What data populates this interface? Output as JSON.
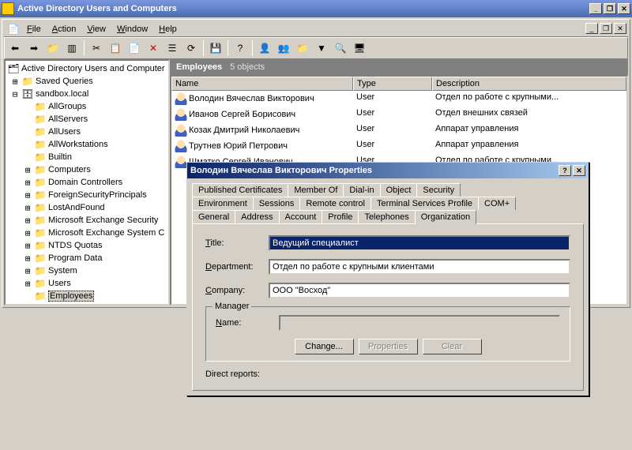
{
  "window": {
    "title": "Active Directory Users and Computers"
  },
  "menu": {
    "file": "File",
    "action": "Action",
    "view": "View",
    "window": "Window",
    "help": "Help"
  },
  "tree": {
    "root": "Active Directory Users and Computer",
    "saved": "Saved Queries",
    "domain": "sandbox.local",
    "nodes": [
      "AllGroups",
      "AllServers",
      "AllUsers",
      "AllWorkstations",
      "Builtin",
      "Computers",
      "Domain Controllers",
      "ForeignSecurityPrincipals",
      "LostAndFound",
      "Microsoft Exchange Security",
      "Microsoft Exchange System C",
      "NTDS Quotas",
      "Program Data",
      "System",
      "Users",
      "Employees"
    ]
  },
  "content": {
    "heading": "Employees",
    "count": "5 objects",
    "cols": {
      "name": "Name",
      "type": "Type",
      "desc": "Description"
    },
    "colw": {
      "name": 230,
      "type": 100,
      "desc": 220
    },
    "rows": [
      {
        "name": "Володин Вячеслав Викторович",
        "type": "User",
        "desc": "Отдел по работе с крупными..."
      },
      {
        "name": "Иванов Сергей Борисович",
        "type": "User",
        "desc": "Отдел внешних связей"
      },
      {
        "name": "Козак Дмитрий Николаевич",
        "type": "User",
        "desc": "Аппарат управления"
      },
      {
        "name": "Трутнев Юрий Петрович",
        "type": "User",
        "desc": "Аппарат управления"
      },
      {
        "name": "Шматко Сергей Иванович",
        "type": "User",
        "desc": "Отдел по работе с крупными..."
      }
    ]
  },
  "dialog": {
    "title": "Володин Вячеслав Викторович Properties",
    "tabs_row1": [
      "Published Certificates",
      "Member Of",
      "Dial-in",
      "Object",
      "Security"
    ],
    "tabs_row2": [
      "Environment",
      "Sessions",
      "Remote control",
      "Terminal Services Profile",
      "COM+"
    ],
    "tabs_row3": [
      "General",
      "Address",
      "Account",
      "Profile",
      "Telephones",
      "Organization"
    ],
    "active_tab": "Organization",
    "fields": {
      "title_label": "Title:",
      "title_value": "Ведущий специалист",
      "dept_label": "Department:",
      "dept_value": "Отдел по работе с крупными клиентами",
      "company_label": "Company:",
      "company_value": "ООО \"Восход\""
    },
    "manager": {
      "group": "Manager",
      "name_label": "Name:",
      "name_value": "",
      "change": "Change...",
      "properties": "Properties",
      "clear": "Clear"
    },
    "reports_label": "Direct reports:"
  }
}
